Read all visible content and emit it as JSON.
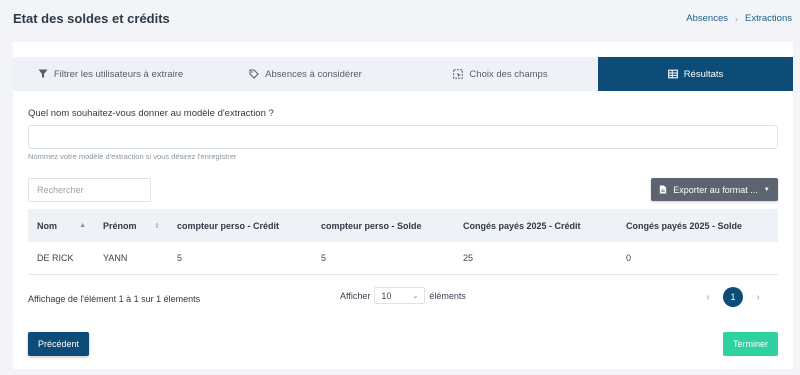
{
  "header": {
    "title": "Etat des soldes et crédits",
    "breadcrumb": [
      "Absences",
      "Extractions"
    ]
  },
  "tabs": [
    {
      "label": "Filtrer les utilisateurs à extraire",
      "icon": "filter-icon",
      "active": false
    },
    {
      "label": "Absences à considérer",
      "icon": "tag-icon",
      "active": false
    },
    {
      "label": "Choix des champs",
      "icon": "select-fields-icon",
      "active": false
    },
    {
      "label": "Résultats",
      "icon": "table-icon",
      "active": true
    }
  ],
  "form": {
    "label": "Quel nom souhaitez-vous donner au modèle d'extraction ?",
    "value": "",
    "help": "Nommez votre modèle d'extraction si vous désirez l'enregistrer"
  },
  "search": {
    "placeholder": "Rechercher"
  },
  "export_button": {
    "label": "Exporter au format ...",
    "icon": "file-icon"
  },
  "table": {
    "columns": [
      "Nom",
      "Prénom",
      "compteur perso - Crédit",
      "compteur perso - Solde",
      "Congés payés 2025 - Crédit",
      "Congés payés 2025 - Solde"
    ],
    "rows": [
      [
        "DE RICK",
        "YANN",
        "5",
        "5",
        "25",
        "0"
      ]
    ]
  },
  "footer": {
    "info": "Affichage de l'élément 1 à 1 sur 1 élements",
    "show_label": "Afficher",
    "page_size": "10",
    "items_label": "éléments",
    "current_page": "1"
  },
  "buttons": {
    "previous": "Précédent",
    "finish": "Terminer"
  },
  "colors": {
    "primary": "#0d4c76",
    "success": "#2fd1a0",
    "export": "#5b6470"
  }
}
